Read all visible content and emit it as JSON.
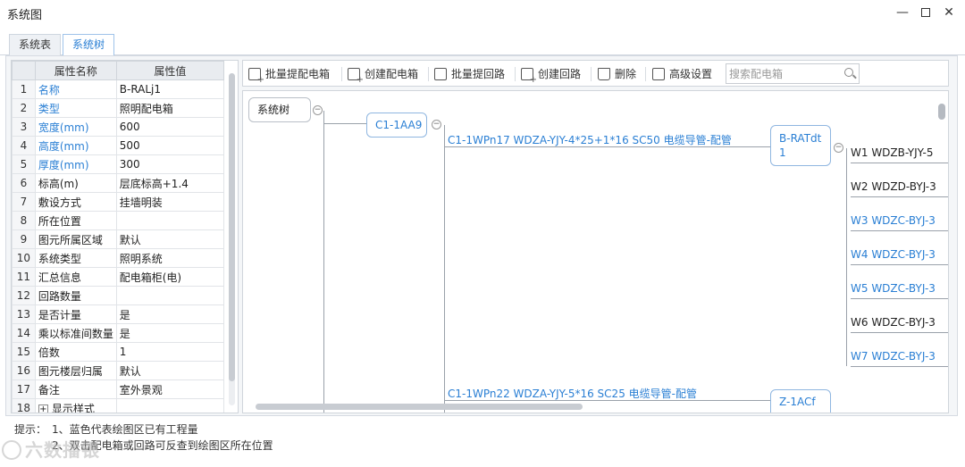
{
  "window": {
    "title": "系统图"
  },
  "tabs": [
    {
      "label": "系统表",
      "active": false
    },
    {
      "label": "系统树",
      "active": true
    }
  ],
  "properties": {
    "headers": [
      "属性名称",
      "属性值"
    ],
    "rows": [
      {
        "index": "1",
        "name": "名称",
        "value": "B-RALj1",
        "highlight": true
      },
      {
        "index": "2",
        "name": "类型",
        "value": "照明配电箱",
        "highlight": true
      },
      {
        "index": "3",
        "name": "宽度(mm)",
        "value": "600",
        "highlight": true
      },
      {
        "index": "4",
        "name": "高度(mm)",
        "value": "500",
        "highlight": true
      },
      {
        "index": "5",
        "name": "厚度(mm)",
        "value": "300",
        "highlight": true
      },
      {
        "index": "6",
        "name": "标高(m)",
        "value": "层底标高+1.4",
        "highlight": false
      },
      {
        "index": "7",
        "name": "敷设方式",
        "value": "挂墙明装",
        "highlight": false
      },
      {
        "index": "8",
        "name": "所在位置",
        "value": "",
        "highlight": false
      },
      {
        "index": "9",
        "name": "图元所属区域",
        "value": "默认",
        "highlight": false
      },
      {
        "index": "10",
        "name": "系统类型",
        "value": "照明系统",
        "highlight": false
      },
      {
        "index": "11",
        "name": "汇总信息",
        "value": "配电箱柜(电)",
        "highlight": false
      },
      {
        "index": "12",
        "name": "回路数量",
        "value": "",
        "highlight": false
      },
      {
        "index": "13",
        "name": "是否计量",
        "value": "是",
        "highlight": false
      },
      {
        "index": "14",
        "name": "乘以标准间数量",
        "value": "是",
        "highlight": false
      },
      {
        "index": "15",
        "name": "倍数",
        "value": "1",
        "highlight": false
      },
      {
        "index": "16",
        "name": "图元楼层归属",
        "value": "默认",
        "highlight": false
      },
      {
        "index": "17",
        "name": "备注",
        "value": "室外景观",
        "highlight": false
      },
      {
        "index": "18",
        "name": "显示样式",
        "value": "",
        "highlight": false,
        "expander": "+"
      }
    ]
  },
  "toolbar": {
    "batch_pick_box": "批量提配电箱",
    "create_box": "创建配电箱",
    "batch_pick_circuit": "批量提回路",
    "create_circuit": "创建回路",
    "delete": "删除",
    "advanced": "高级设置",
    "search_placeholder": "搜索配电箱"
  },
  "tree": {
    "root": "系统树",
    "box1": "C1-1AA9",
    "cable1": "C1-1WPn17 WDZA-YJY-4*25+1*16 SC50 电缆导管-配管",
    "box2_line1": "B-RATdt",
    "box2_line2": "1",
    "cable2": "C1-1WPn22 WDZA-YJY-5*16 SC25 电缆导管-配管",
    "box3_partial": "Z-1ACf",
    "collapse_glyph": "−",
    "leaves": [
      {
        "text": "W1 WDZB-YJY-5",
        "color": "dark"
      },
      {
        "text": "W2 WDZD-BYJ-3",
        "color": "dark"
      },
      {
        "text": "W3 WDZC-BYJ-3",
        "color": "blue"
      },
      {
        "text": "W4 WDZC-BYJ-3",
        "color": "blue"
      },
      {
        "text": "W5 WDZC-BYJ-3",
        "color": "blue"
      },
      {
        "text": "W6 WDZC-BYJ-3",
        "color": "dark"
      },
      {
        "text": "W7 WDZC-BYJ-3",
        "color": "blue"
      }
    ]
  },
  "hints": {
    "label": "提示：",
    "line1": "1、蓝色代表绘图区已有工程量",
    "line2": "2、双击配电箱或回路可反查到绘图区所在位置"
  },
  "watermark": {
    "text": "六数播银"
  }
}
